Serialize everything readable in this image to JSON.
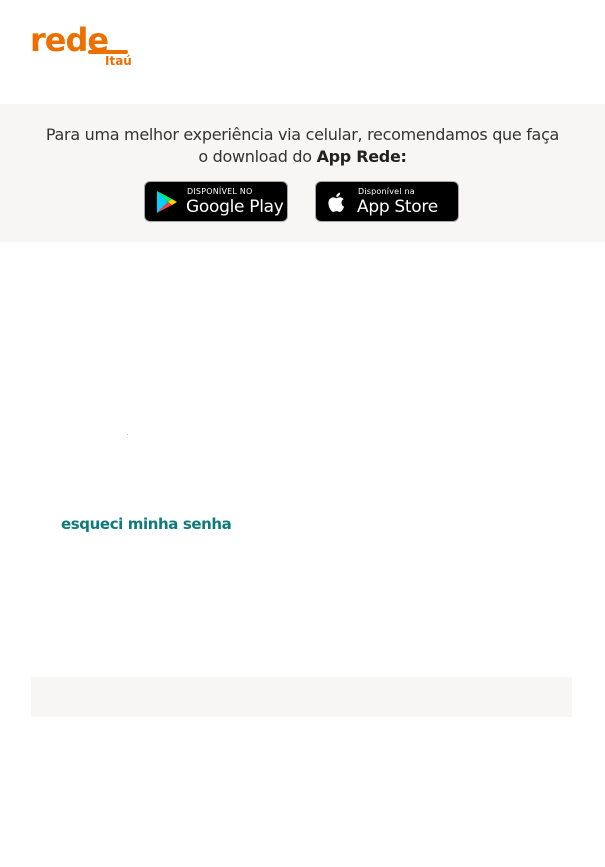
{
  "brand": {
    "logo_text": "rede",
    "logo_sub": "Itaú",
    "color": "#ec7000"
  },
  "banner": {
    "text_prefix": "Para uma melhor experiência via celular, recomendamos que faça o download do ",
    "text_bold": "App Rede:",
    "google_play": {
      "small_label": "DISPONÍVEL NO",
      "big_label": "Google Play",
      "icon": "google-play-icon"
    },
    "app_store": {
      "small_label": "Disponível na",
      "big_label": "App Store",
      "icon": "apple-icon"
    }
  },
  "login": {
    "forgot_password_label": "esqueci minha senha",
    "link_color": "#0f7a7a"
  }
}
